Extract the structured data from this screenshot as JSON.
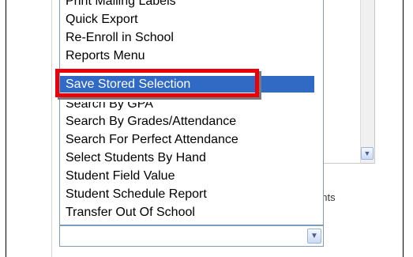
{
  "dropdown": {
    "items": [
      {
        "label": "Print Mailing Labels"
      },
      {
        "label": "Quick Export"
      },
      {
        "label": "Re-Enroll in School"
      },
      {
        "label": "Reports Menu"
      },
      {
        "label": "Save Stored Selection",
        "selected": true
      },
      {
        "label": "Search By GPA"
      },
      {
        "label": "Search By Grades/Attendance"
      },
      {
        "label": "Search For Perfect Attendance"
      },
      {
        "label": "Select Students By Hand"
      },
      {
        "label": "Student Field Value"
      },
      {
        "label": "Student Schedule Report"
      },
      {
        "label": "Transfer Out Of School"
      }
    ],
    "selected_value": "",
    "arrow_icon": "chevron-down-icon",
    "highlight_color": "#e8000b",
    "selection_color": "#316ac5"
  },
  "background": {
    "partial_text": "ents"
  },
  "right_panel": {
    "scroll_icon": "chevron-down-icon"
  }
}
